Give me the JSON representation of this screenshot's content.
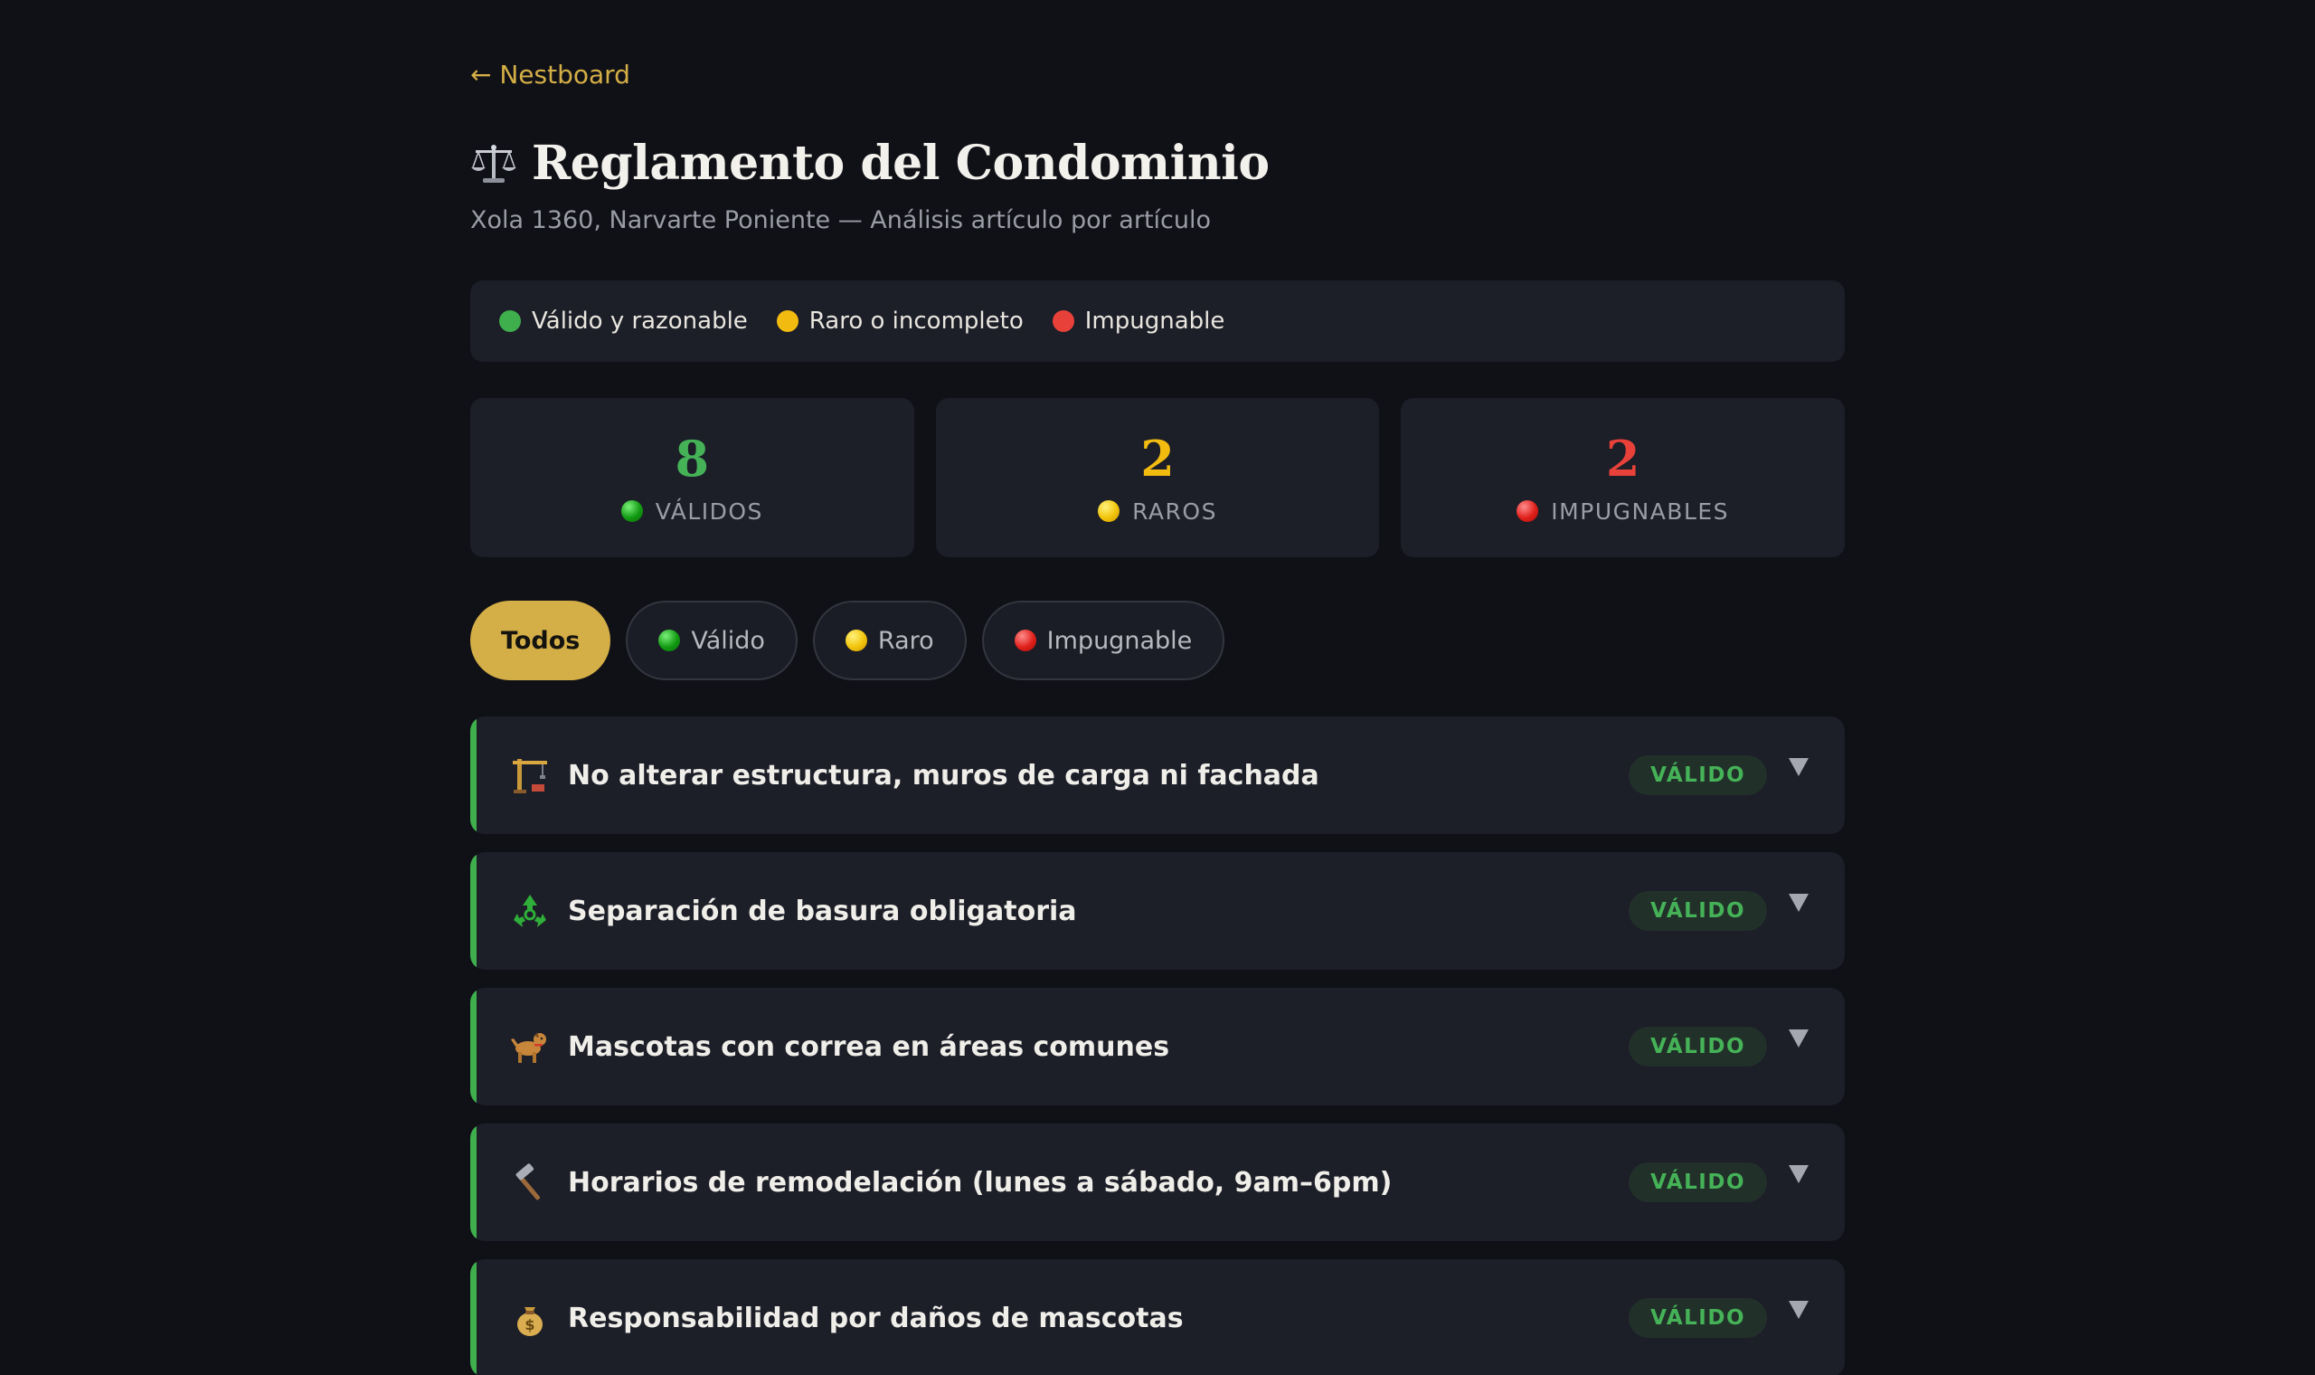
{
  "nav": {
    "back_label": "← Nestboard"
  },
  "header": {
    "title": "Reglamento del Condominio",
    "subtitle": "Xola 1360, Narvarte Poniente — Análisis artículo por artículo",
    "icon": "scales-icon"
  },
  "legend": [
    {
      "label": "Válido y razonable",
      "color": "#3fae4c"
    },
    {
      "label": "Raro o incompleto",
      "color": "#f2bb10"
    },
    {
      "label": "Impugnable",
      "color": "#e8413a"
    }
  ],
  "stats": [
    {
      "count": "8",
      "label": "VÁLIDOS",
      "color": "#45b257"
    },
    {
      "count": "2",
      "label": "RAROS",
      "color": "#f2bb10"
    },
    {
      "count": "2",
      "label": "IMPUGNABLES",
      "color": "#e8413a"
    }
  ],
  "filters": {
    "all": "Todos",
    "valid": "Válido",
    "odd": "Raro",
    "challengeable": "Impugnable",
    "selected": "Todos"
  },
  "rules": [
    {
      "icon": "construction-crane-icon",
      "title": "No alterar estructura, muros de carga ni fachada",
      "status": "VÁLIDO"
    },
    {
      "icon": "recycle-icon",
      "title": "Separación de basura obligatoria",
      "status": "VÁLIDO"
    },
    {
      "icon": "dog-icon",
      "title": "Mascotas con correa en áreas comunes",
      "status": "VÁLIDO"
    },
    {
      "icon": "hammer-icon",
      "title": "Horarios de remodelación (lunes a sábado, 9am–6pm)",
      "status": "VÁLIDO"
    },
    {
      "icon": "money-bag-icon",
      "title": "Responsabilidad por daños de mascotas",
      "status": "VÁLIDO"
    }
  ],
  "colors": {
    "accent": "#d4ae46",
    "background": "#101117",
    "card": "#1c1e28",
    "valid": "#3fae4c"
  }
}
